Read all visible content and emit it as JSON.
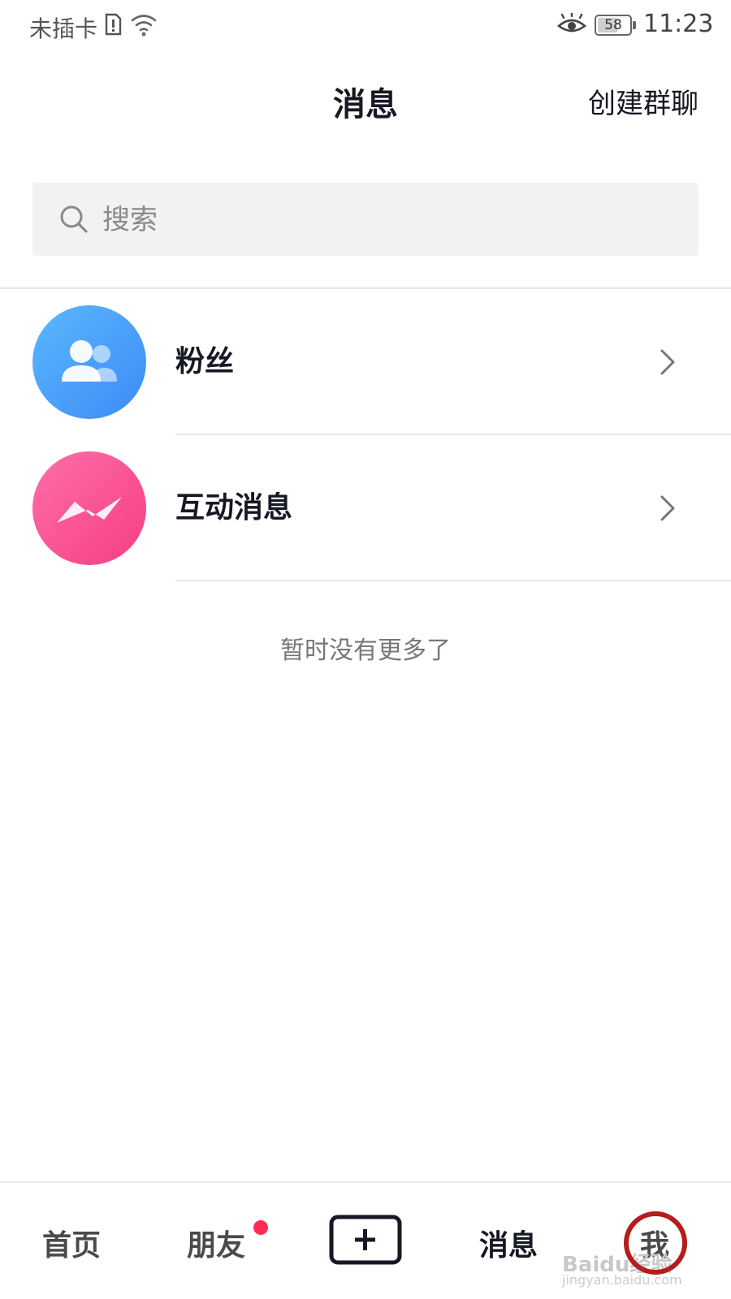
{
  "status_bar": {
    "carrier": "未插卡",
    "battery_level": "58",
    "time": "11:23"
  },
  "header": {
    "title": "消息",
    "create_group": "创建群聊"
  },
  "search": {
    "placeholder": "搜索"
  },
  "list": {
    "items": [
      {
        "label": "粉丝",
        "icon": "fans-icon"
      },
      {
        "label": "互动消息",
        "icon": "interaction-icon"
      }
    ]
  },
  "empty_text": "暂时没有更多了",
  "bottom_nav": {
    "home": "首页",
    "friends": "朋友",
    "add": "add-icon",
    "messages": "消息",
    "me": "我",
    "active": "消息"
  },
  "watermark": {
    "brand": "Baidu经验",
    "url": "jingyan.baidu.com"
  },
  "colors": {
    "badge": "#fe2c55",
    "fans_avatar": "#3c8af5",
    "interaction_avatar": "#f53d84",
    "annotation_circle": "#b51d1d"
  }
}
